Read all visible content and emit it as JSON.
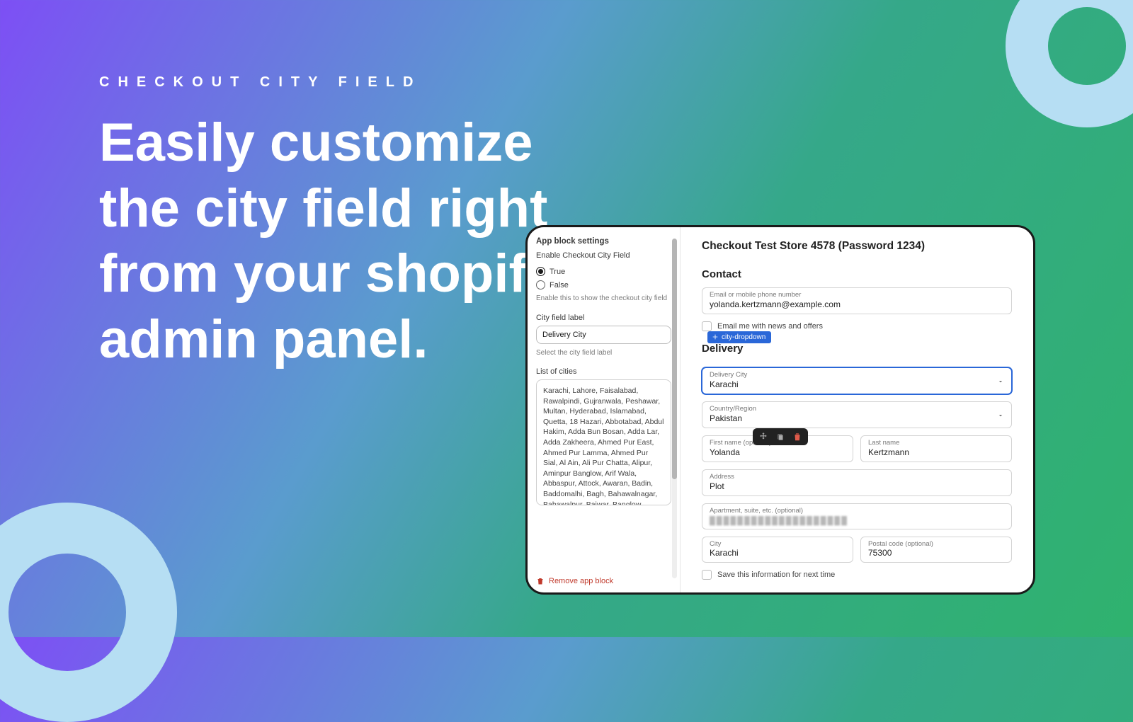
{
  "marketing": {
    "eyebrow": "CHECKOUT CITY FIELD",
    "headline": "Easily customize the city field right from your shopify admin panel."
  },
  "settings": {
    "title": "App block settings",
    "enable_label": "Enable Checkout City Field",
    "true_label": "True",
    "false_label": "False",
    "enable_help": "Enable this to show the checkout city field",
    "field_label_heading": "City field label",
    "field_label_value": "Delivery City",
    "field_label_help": "Select the city field label",
    "list_heading": "List of cities",
    "cities_text": "Karachi, Lahore, Faisalabad, Rawalpindi, Gujranwala, Peshawar, Multan, Hyderabad, Islamabad, Quetta, 18 Hazari, Abbotabad, Abdul Hakim, Adda Bun Bosan, Adda Lar, Adda Zakheera, Ahmed Pur East, Ahmed Pur Lamma, Ahmed Pur Sial, Al Ain, Ali Pur Chatta, Alipur, Aminpur Banglow, Arif Wala, Abbaspur, Attock, Awaran, Badin, Baddomalhi, Bagh, Bahawalnagar, Bahawalpur, Bajwar, Banglow Gogera, Bannu, Bara Kahu, Barkhan, Barnala, Basir Pur, Basti Malook,",
    "remove_label": "Remove app block"
  },
  "checkout": {
    "store_title": "Checkout Test Store 4578 (Password 1234)",
    "contact_heading": "Contact",
    "email_label": "Email or mobile phone number",
    "email_value": "yolanda.kertzmann@example.com",
    "news_label": "Email me with news and offers",
    "delivery_heading": "Delivery",
    "badge_text": "city-dropdown",
    "delivery_city_label": "Delivery City",
    "delivery_city_value": "Karachi",
    "country_label": "Country/Region",
    "country_value": "Pakistan",
    "first_name_label": "First name (optional)",
    "first_name_value": "Yolanda",
    "last_name_label": "Last name",
    "last_name_value": "Kertzmann",
    "address_label": "Address",
    "address_value": "Plot",
    "apt_label": "Apartment, suite, etc. (optional)",
    "city_label": "City",
    "city_value": "Karachi",
    "postal_label": "Postal code (optional)",
    "postal_value": "75300",
    "save_label": "Save this information for next time"
  }
}
